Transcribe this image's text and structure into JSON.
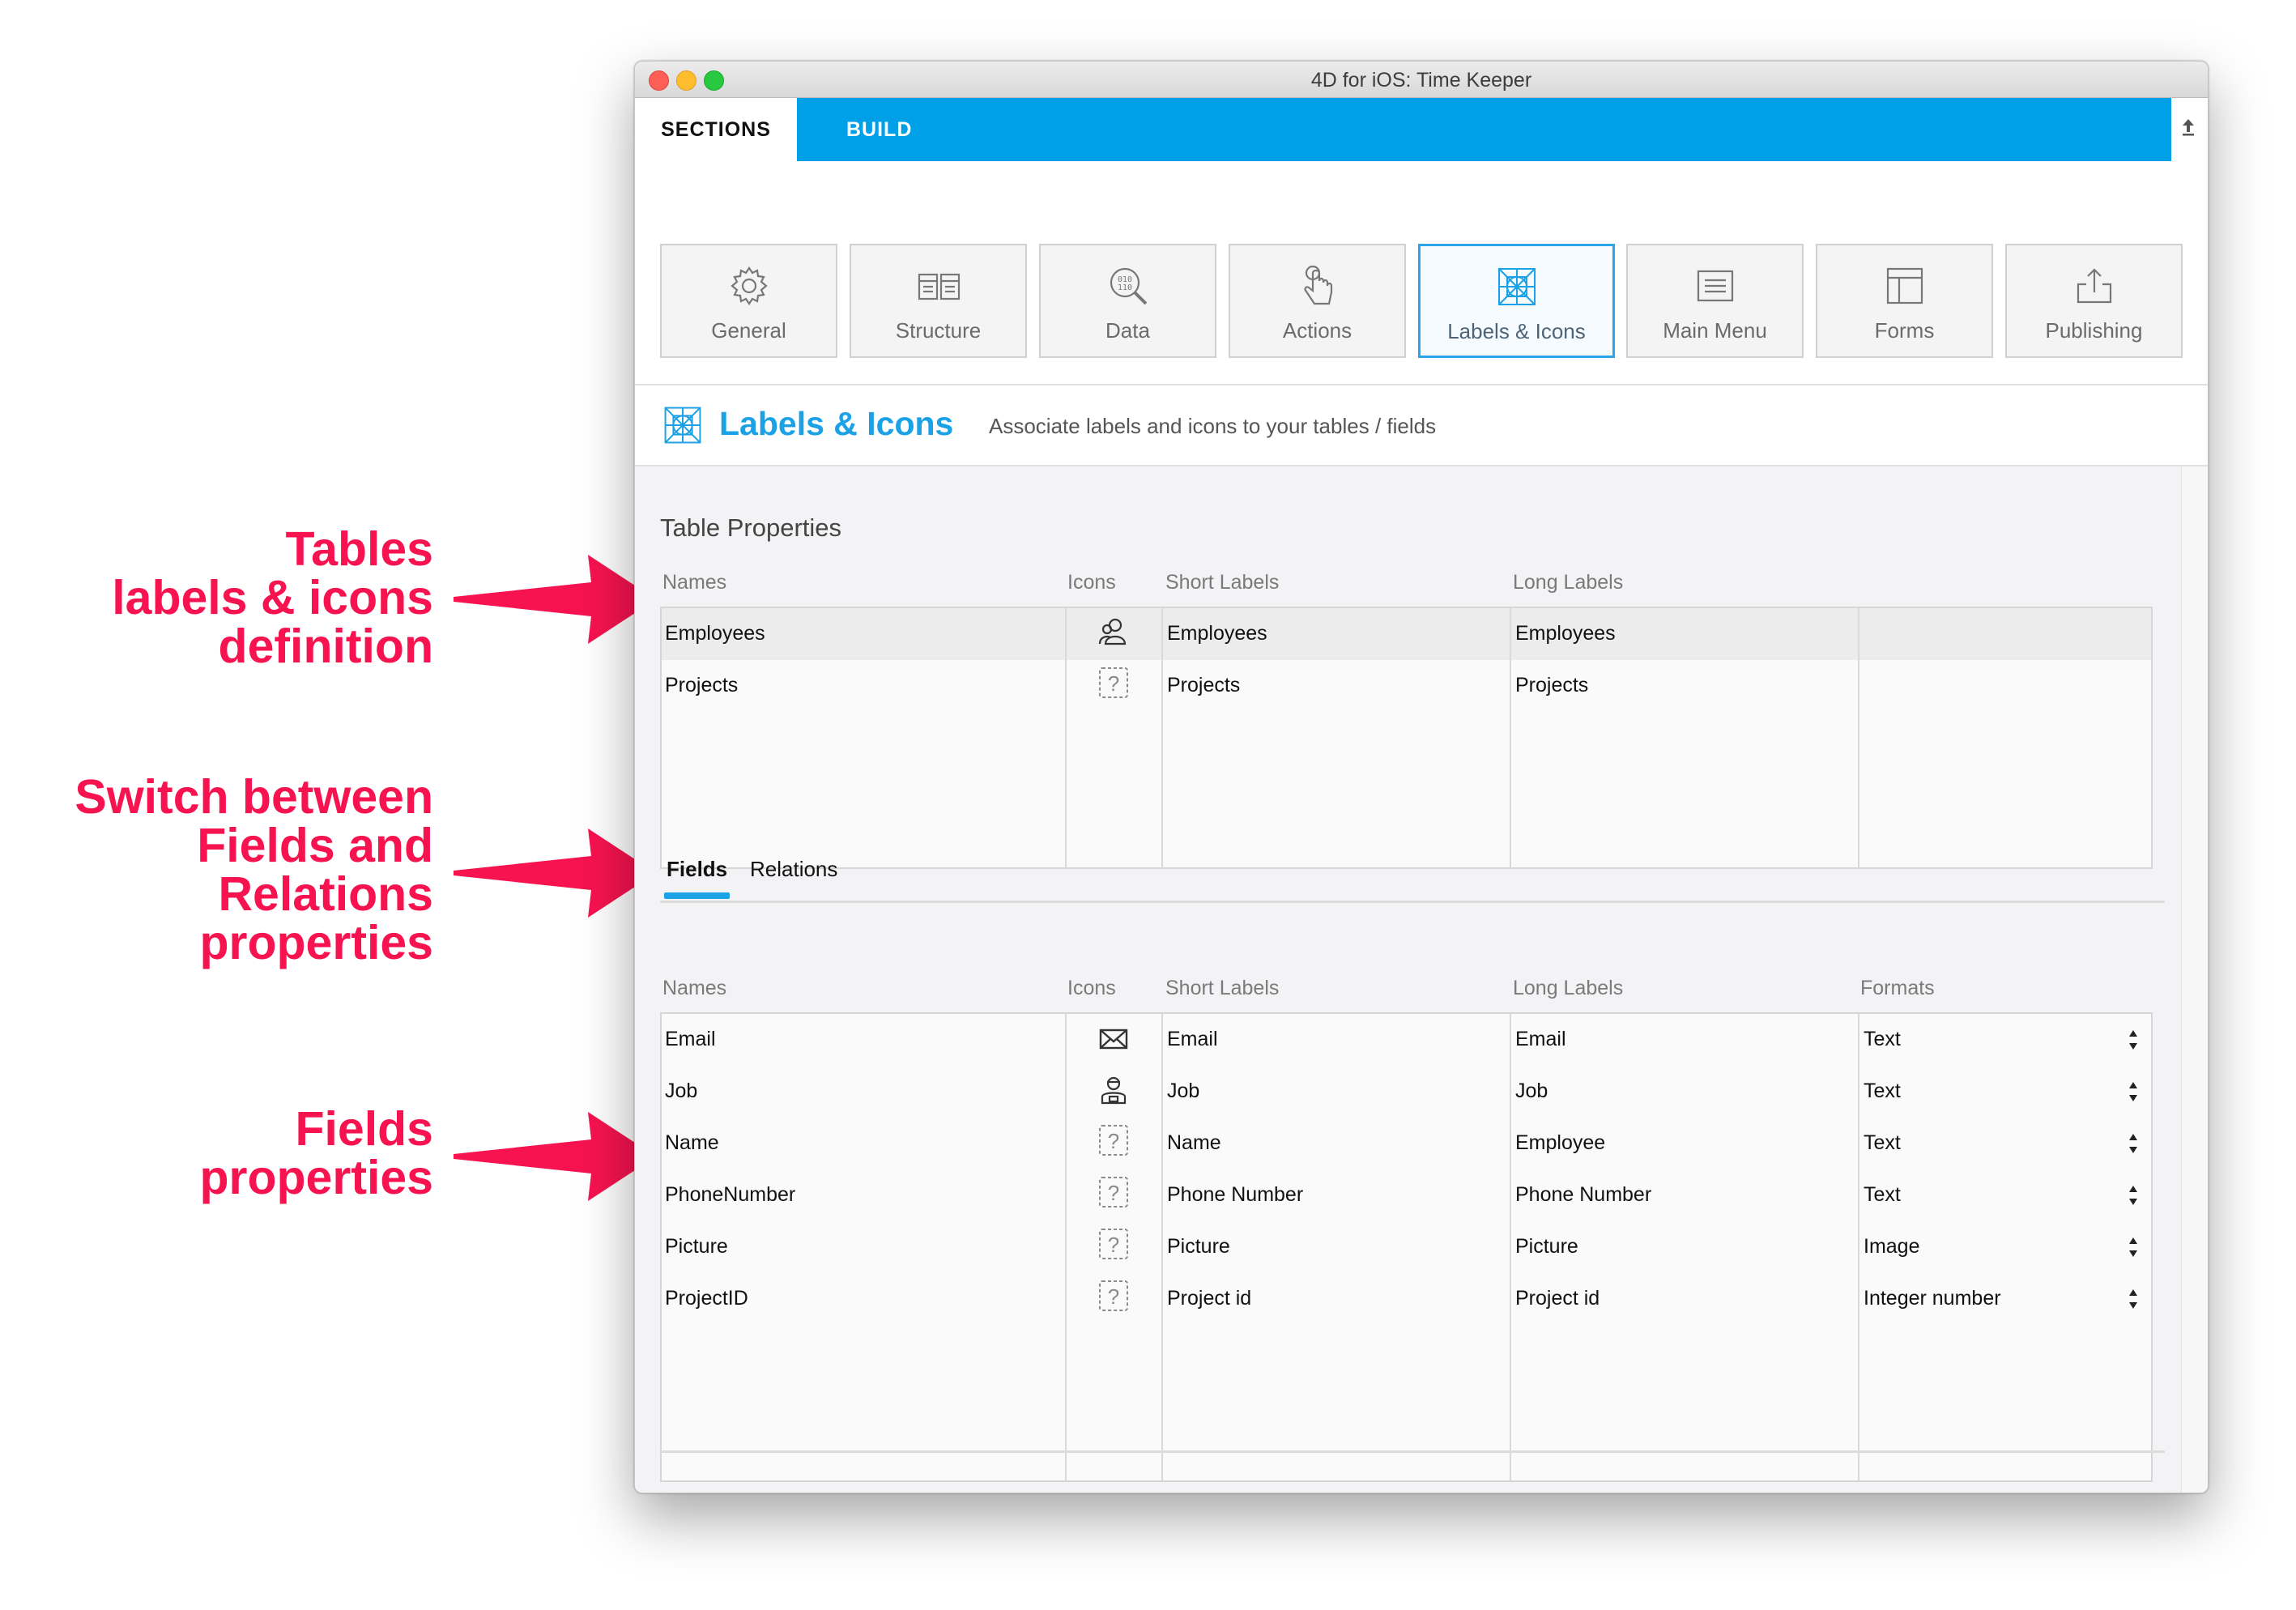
{
  "annotations": [
    {
      "lines": [
        "Tables",
        "labels & icons",
        "definition"
      ]
    },
    {
      "lines": [
        "Switch between",
        "Fields and",
        "Relations",
        "properties"
      ]
    },
    {
      "lines": [
        "Fields",
        "properties"
      ]
    }
  ],
  "window": {
    "title": "4D for iOS: Time Keeper",
    "tabs": {
      "sections": "SECTIONS",
      "build": "BUILD"
    }
  },
  "sections": [
    {
      "label": "General",
      "icon": "gear-icon"
    },
    {
      "label": "Structure",
      "icon": "structure-icon"
    },
    {
      "label": "Data",
      "icon": "data-search-icon"
    },
    {
      "label": "Actions",
      "icon": "touch-icon"
    },
    {
      "label": "Labels & Icons",
      "icon": "labels-icons-icon",
      "active": true
    },
    {
      "label": "Main Menu",
      "icon": "menu-icon"
    },
    {
      "label": "Forms",
      "icon": "forms-icon"
    },
    {
      "label": "Publishing",
      "icon": "publish-icon"
    }
  ],
  "section_header": {
    "title": "Labels & Icons",
    "description": "Associate labels and icons to your tables / fields"
  },
  "table_properties": {
    "title": "Table Properties",
    "columns": [
      "Names",
      "Icons",
      "Short Labels",
      "Long Labels"
    ],
    "rows": [
      {
        "name": "Employees",
        "icon": "people-icon",
        "short": "Employees",
        "long": "Employees",
        "selected": true
      },
      {
        "name": "Projects",
        "icon": "question-icon",
        "short": "Projects",
        "long": "Projects"
      }
    ]
  },
  "subtabs": {
    "fields": "Fields",
    "relations": "Relations",
    "active": "fields"
  },
  "fields": {
    "columns": [
      "Names",
      "Icons",
      "Short Labels",
      "Long Labels",
      "Formats"
    ],
    "rows": [
      {
        "name": "Email",
        "icon": "envelope-icon",
        "short": "Email",
        "long": "Email",
        "format": "Text"
      },
      {
        "name": "Job",
        "icon": "worker-icon",
        "short": "Job",
        "long": "Job",
        "format": "Text"
      },
      {
        "name": "Name",
        "icon": "question-icon",
        "short": "Name",
        "long": "Employee",
        "format": "Text"
      },
      {
        "name": "PhoneNumber",
        "icon": "question-icon",
        "short": "Phone Number",
        "long": "Phone Number",
        "format": "Text"
      },
      {
        "name": "Picture",
        "icon": "question-icon",
        "short": "Picture",
        "long": "Picture",
        "format": "Image"
      },
      {
        "name": "ProjectID",
        "icon": "question-icon",
        "short": "Project id",
        "long": "Project id",
        "format": "Integer number"
      }
    ]
  },
  "colors": {
    "accent": "#00a0e9",
    "annotation": "#f7134f"
  }
}
